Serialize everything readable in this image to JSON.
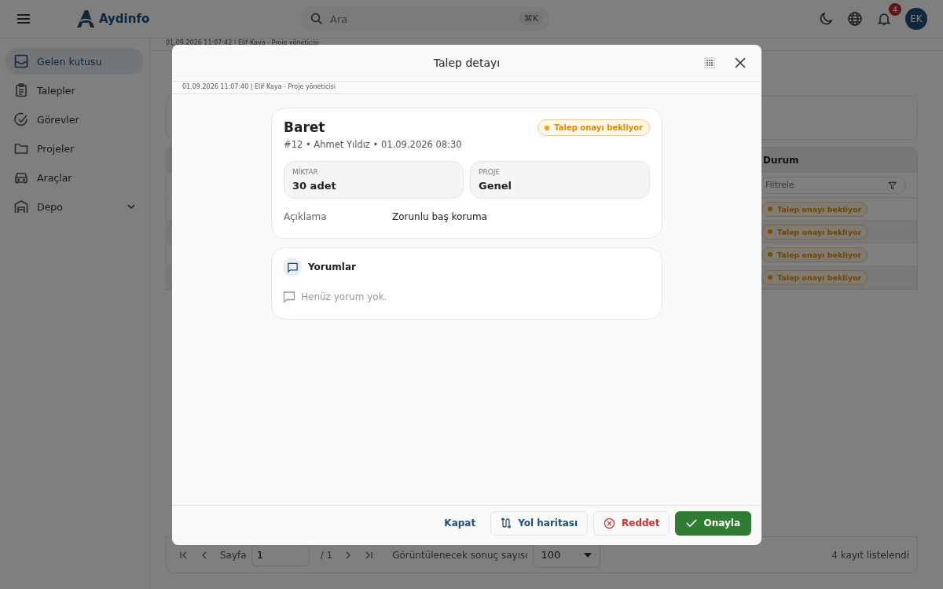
{
  "topbar": {
    "logo": "Aydinfo",
    "search": {
      "placeholder": "Ara",
      "shortcut": "⌘K"
    },
    "notifications": "4",
    "avatar": "EK"
  },
  "sidebar": {
    "items": [
      {
        "label": "Gelen kutusu",
        "selected": true
      },
      {
        "label": "Talepler",
        "selected": false
      },
      {
        "label": "Görevler",
        "selected": false
      },
      {
        "label": "Projeler",
        "selected": false
      },
      {
        "label": "Araçlar",
        "selected": false
      },
      {
        "label": "Depo",
        "selected": false,
        "expanded": false
      }
    ]
  },
  "breadcrumb": "01.09.2026 11:07:42 | Elif Kaya - Proje yöneticisi",
  "table": {
    "columns": [
      "Durum"
    ],
    "filter_placeholder": "Filtrele",
    "rows": [
      {
        "status": "Talep onayı bekliyor"
      },
      {
        "status": "Talep onayı bekliyor"
      },
      {
        "status": "Talep onayı bekliyor"
      },
      {
        "status": "Talep onayı bekliyor"
      }
    ]
  },
  "pagination": {
    "page_label": "Sayfa",
    "page": "1",
    "total": "/ 1",
    "page_size_label": "Görüntülenecek sonuç sayısı",
    "page_size": "100",
    "count": "4 kayıt listelendi"
  },
  "modal": {
    "title": "Talep detayı",
    "subtitle": "01.09.2026 11:07:40 | Elif Kaya - Proje yöneticisi",
    "item": {
      "name": "Baret",
      "status": "Talep onayı bekliyor",
      "meta": "#12 • Ahmet Yıldız • 01.09.2026 08:30",
      "fields": [
        {
          "label": "MİKTAR",
          "value": "30 adet"
        },
        {
          "label": "PROJE",
          "value": "Genel"
        }
      ],
      "description_label": "Açıklama",
      "description": "Zorunlu baş koruma"
    },
    "comments": {
      "title": "Yorumlar",
      "empty": "Henüz yorum yok."
    },
    "buttons": [
      {
        "label": "Kapat",
        "kind": "text"
      },
      {
        "label": "Yol haritası",
        "kind": "route"
      },
      {
        "label": "Reddet",
        "kind": "reject"
      },
      {
        "label": "Onayla",
        "kind": "approve"
      }
    ]
  }
}
